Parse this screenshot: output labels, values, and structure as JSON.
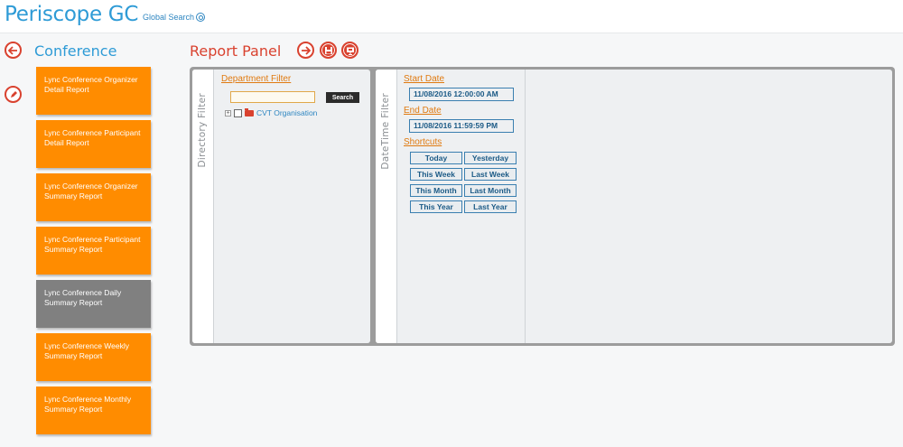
{
  "header": {
    "app_title": "Periscope GC",
    "global_search_label": "Global Search"
  },
  "sidebar": {
    "title": "Conference",
    "reports": [
      {
        "label": "Lync Conference Organizer Detail Report",
        "active": false
      },
      {
        "label": "Lync Conference Participant Detail Report",
        "active": false
      },
      {
        "label": "Lync Conference Organizer Summary Report",
        "active": false
      },
      {
        "label": "Lync Conference Participant Summary Report",
        "active": false
      },
      {
        "label": "Lync Conference Daily Summary Report",
        "active": true
      },
      {
        "label": "Lync Conference Weekly Summary Report",
        "active": false
      },
      {
        "label": "Lync Conference Monthly Summary Report",
        "active": false
      }
    ]
  },
  "panel": {
    "title": "Report Panel",
    "directory_filter": {
      "tab_label": "Directory Filter",
      "department_filter_label": "Department Filter",
      "search_value": "",
      "search_button": "Search",
      "tree_root": "CVT Organisation"
    },
    "datetime_filter": {
      "tab_label": "DateTime Filter",
      "start_date_label": "Start Date",
      "start_date_value": "11/08/2016 12:00:00 AM",
      "end_date_label": "End Date",
      "end_date_value": "11/08/2016 11:59:59 PM",
      "shortcuts_label": "Shortcuts",
      "shortcuts": [
        "Today",
        "Yesterday",
        "This Week",
        "Last Week",
        "This Month",
        "Last Month",
        "This Year",
        "Last Year"
      ]
    }
  },
  "icons": {
    "back": "arrow-left-icon",
    "edit": "pencil-icon",
    "run": "arrow-right-icon",
    "save": "floppy-disk-icon",
    "schedule": "presentation-icon"
  },
  "colors": {
    "brand_blue": "#2e9bd6",
    "accent_red": "#d9422f",
    "report_orange": "#ff8c00",
    "report_active_gray": "#808080"
  }
}
